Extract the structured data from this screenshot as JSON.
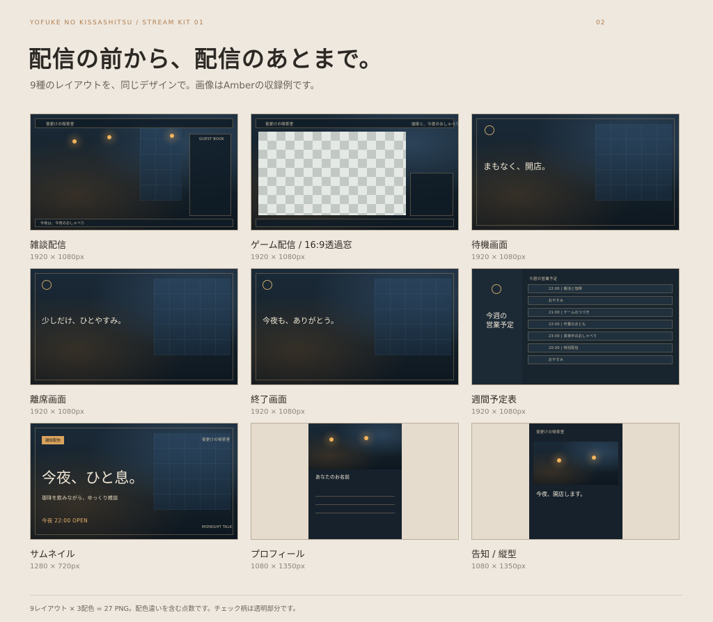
{
  "header": {
    "kicker": "YOFUKE NO KISSASHITSU  /  STREAM KIT 01",
    "page_number": "02",
    "headline": "配信の前から、配信のあとまで。",
    "subline": "9種のレイアウトを、同じデザインで。画像はAmberの収録例です。"
  },
  "cards": [
    {
      "title": "雑談配信",
      "size": "1920 × 1080px"
    },
    {
      "title": "ゲーム配信 / 16:9透過窓",
      "size": "1920 × 1080px"
    },
    {
      "title": "待機画面",
      "size": "1920 × 1080px"
    },
    {
      "title": "離席画面",
      "size": "1920 × 1080px"
    },
    {
      "title": "終了画面",
      "size": "1920 × 1080px"
    },
    {
      "title": "週間予定表",
      "size": "1920 × 1080px"
    },
    {
      "title": "サムネイル",
      "size": "1280 × 720px"
    },
    {
      "title": "プロフィール",
      "size": "1080 × 1350px"
    },
    {
      "title": "告知 / 縦型",
      "size": "1080 × 1350px"
    }
  ],
  "thumbs": {
    "chat": {
      "title": "夜更けの喫茶室",
      "guest": "GUEST BOOK",
      "bottom": "今夜は、今宵のおしゃべり"
    },
    "game": {
      "title": "夜更けの喫茶室",
      "right": "珈琲と、今夜のおしゃべり"
    },
    "waiting": {
      "main": "まもなく、開店。"
    },
    "away": {
      "main": "少しだけ、ひとやすみ。"
    },
    "ending": {
      "main": "今夜も、ありがとう。"
    },
    "schedule": {
      "heading": "今週の営業予定",
      "side": "今週の\n営業予定",
      "rows": [
        "22:00 | 朝活と珈琲",
        "おやすみ",
        "21:00 | ゲームのつづき",
        "22:00 | 作業のおとも",
        "23:00 | 真夜中のおしゃべり",
        "20:00 | 特別配信",
        "おやすみ"
      ]
    },
    "thumbnail": {
      "tag": "雑談配信",
      "shop": "夜更けの喫茶室",
      "main": "今夜、ひと息。",
      "sub": "珈琲を飲みながら、ゆっくり雑談",
      "time": "今夜 22:00 OPEN",
      "corner": "MIDNIGHT TALK"
    },
    "profile": {
      "name": "あなたのお名前"
    },
    "announce": {
      "shop": "夜更けの喫茶室",
      "main": "今夜、開店します。"
    }
  },
  "footer": "9レイアウト × 3配色 = 27 PNG。配色違いを含む点数です。チェック柄は透明部分です。"
}
